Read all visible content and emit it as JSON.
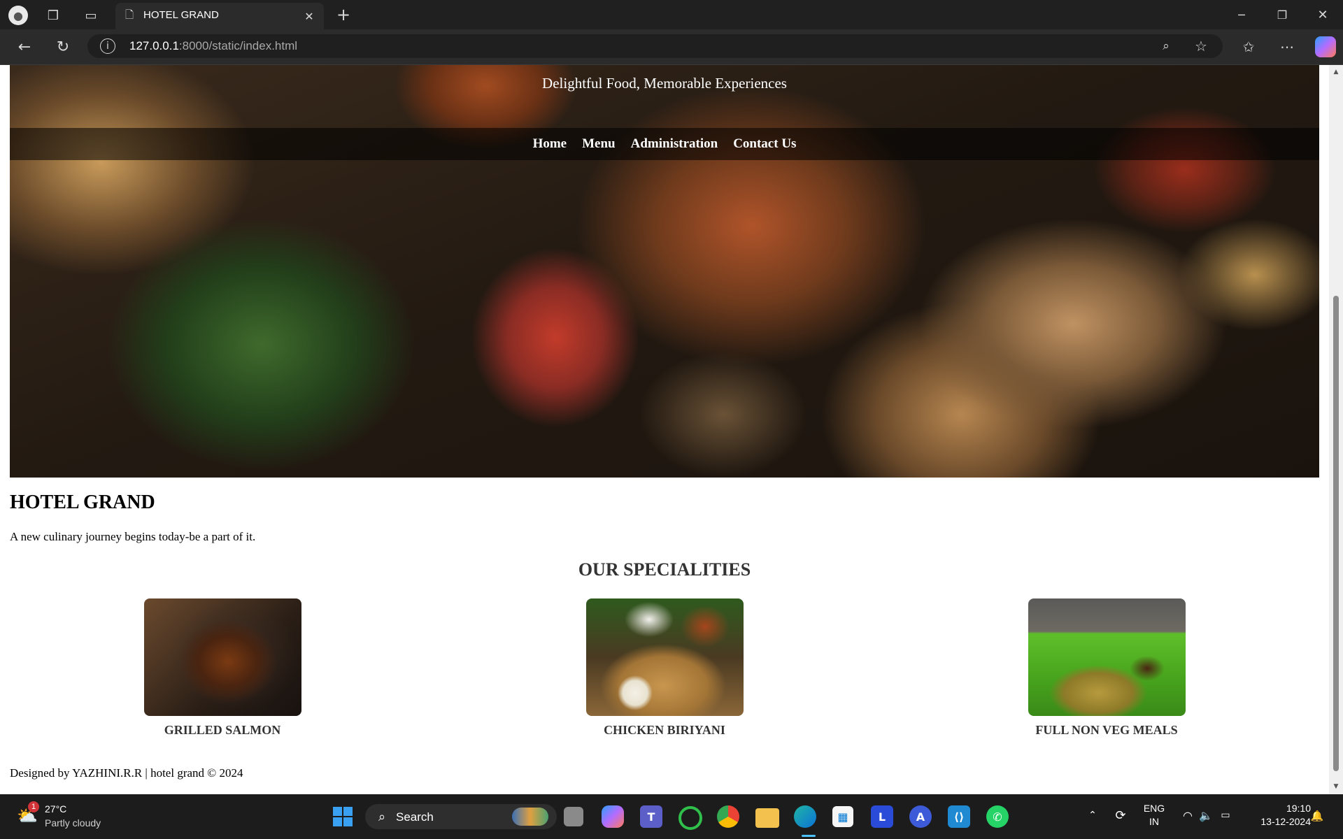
{
  "browser": {
    "tab_title": "HOTEL GRAND",
    "url_host": "127.0.0.1",
    "url_rest": ":8000/static/index.html",
    "icons": [
      "profile-icon",
      "workspaces-icon",
      "tab-actions-icon",
      "page-icon",
      "close-tab-icon",
      "new-tab-icon",
      "minimize-icon",
      "restore-icon",
      "close-window-icon",
      "back-icon",
      "refresh-icon",
      "info-icon",
      "zoom-icon",
      "favorite-icon",
      "favorites-icon",
      "more-icon",
      "copilot-icon"
    ]
  },
  "page": {
    "tagline": "Delightful Food, Memorable Experiences",
    "nav": [
      "Home",
      "Menu",
      "Administration",
      "Contact Us"
    ],
    "title": "HOTEL GRAND",
    "intro": "A new culinary journey begins today-be a part of it.",
    "specialities_heading": "OUR SPECIALITIES",
    "specialities": [
      {
        "name": "GRILLED SALMON"
      },
      {
        "name": "CHICKEN BIRIYANI"
      },
      {
        "name": "FULL NON VEG MEALS"
      }
    ],
    "footer": "Designed by YAZHINI.R.R | hotel grand © 2024"
  },
  "taskbar": {
    "weather_temp": "27°C",
    "weather_desc": "Partly cloudy",
    "weather_badge": "1",
    "search_label": "Search",
    "lang_line1": "ENG",
    "lang_line2": "IN",
    "time": "19:10",
    "date": "13-12-2024"
  },
  "colors": {
    "accent_edge": "#0a84ff",
    "nav_text": "#ffffff",
    "heading": "#333333"
  }
}
